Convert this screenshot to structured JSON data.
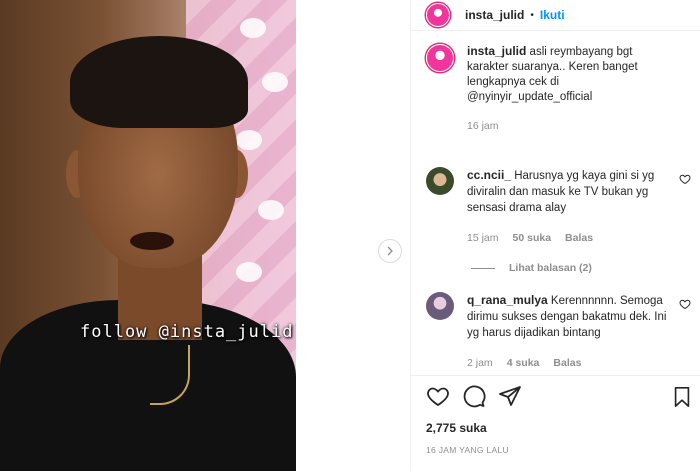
{
  "post": {
    "username": "insta_julid",
    "separator": "•",
    "follow_label": "Ikuti",
    "video_overlay_text": "follow @insta_julid"
  },
  "caption": {
    "username": "insta_julid",
    "text": "asli reymbayang bgt karakter suaranya.. Keren banget lengkapnya cek di @nyinyir_update_official",
    "time": "16 jam"
  },
  "comments": [
    {
      "username": "cc.ncii_",
      "text": "Harusnya yg kaya gini si yg diviralin dan masuk ke TV bukan yg sensasi drama alay",
      "time": "15 jam",
      "likes": "50 suka",
      "reply_label": "Balas",
      "view_replies": "Lihat balasan (2)"
    },
    {
      "username": "q_rana_mulya",
      "text": "Kerennnnnn. Semoga dirimu sukses dengan bakatmu dek. Ini yg harus dijadikan bintang",
      "time": "2 jam",
      "likes": "4 suka",
      "reply_label": "Balas"
    }
  ],
  "footer": {
    "likes_count": "2,775 suka",
    "posted_ago": "16 JAM YANG LALU"
  },
  "colors": {
    "accent": "#0095f6",
    "text": "#262626",
    "muted": "#8e8e8e",
    "border": "#efefef"
  },
  "icons": [
    "chevron-right-icon",
    "heart-icon",
    "comment-icon",
    "share-icon",
    "bookmark-icon"
  ]
}
